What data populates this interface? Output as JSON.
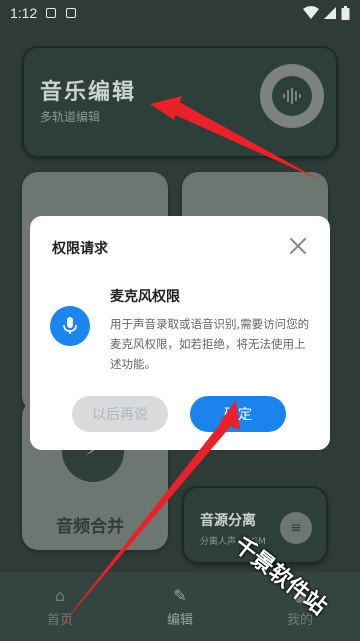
{
  "status_bar": {
    "time": "1:12"
  },
  "background": {
    "top_card": {
      "title": "音乐编辑",
      "subtitle": "多轨道编辑"
    },
    "merge_card": {
      "label": "音频合并"
    },
    "separate_card": {
      "label": "音源分离",
      "subtitle": "分离人声，BGM"
    },
    "bottom_nav": [
      {
        "label": "首页"
      },
      {
        "label": "编辑"
      },
      {
        "label": "我的"
      }
    ]
  },
  "dialog": {
    "title": "权限请求",
    "permission_title": "麦克风权限",
    "permission_desc": "用于声音录取或语音识别,需要访问您的麦克风权限，如若拒绝，将无法使用上述功能。",
    "later_label": "以后再说",
    "confirm_label": "确定"
  },
  "watermark": "千景软件站",
  "colors": {
    "accent": "#1a83ec",
    "arrow": "#e8212a"
  }
}
